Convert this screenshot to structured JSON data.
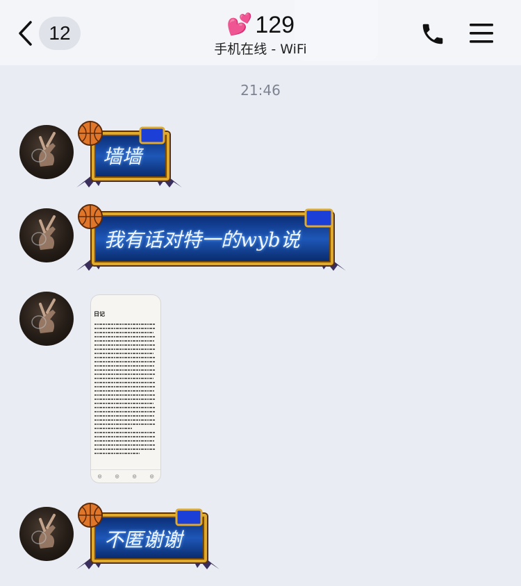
{
  "header": {
    "back_count": "12",
    "title_emoji": "💕",
    "title": "129",
    "subtitle": "手机在线 - WiFi"
  },
  "chat": {
    "timestamp": "21:46",
    "messages": [
      {
        "type": "text",
        "text": "墙墙"
      },
      {
        "type": "text",
        "text": "我有话对特一的wyb说"
      },
      {
        "type": "image",
        "image_title": "日记"
      },
      {
        "type": "text",
        "text": "不匿谢谢"
      }
    ]
  },
  "colors": {
    "background": "#e9ecf3",
    "header_bg": "#f3f5f9",
    "bubble_blue": "#1e57b8",
    "bubble_gold": "#e0aa2c"
  },
  "icons": [
    "back-chevron-icon",
    "phone-icon",
    "menu-icon",
    "basketball-icon",
    "bat-wing-icon"
  ]
}
